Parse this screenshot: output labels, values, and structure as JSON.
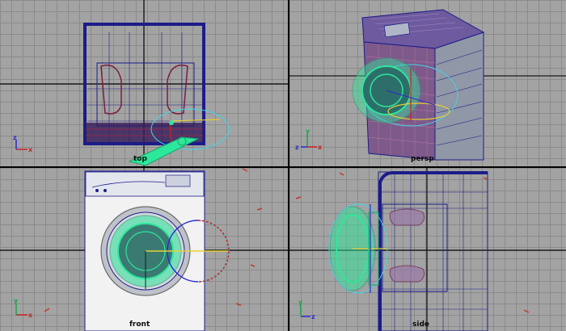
{
  "viewports": {
    "top": {
      "label": "top"
    },
    "persp": {
      "label": "persp"
    },
    "front": {
      "label": "front"
    },
    "side": {
      "label": "side"
    }
  },
  "axis": {
    "x_label": "x",
    "y_label": "y",
    "z_label": "z"
  },
  "colors": {
    "grid_background": "#a3a3a3",
    "grid_line": "#8b8b8b",
    "axis_line": "#1a1a1a",
    "wireframe": "#1c1c88",
    "selection": "#2de79b",
    "manip_cyan": "#41d6e8",
    "manip_red": "#c82222",
    "manip_yellow": "#e8d034",
    "manip_blue": "#2b2bd0",
    "cabinet": "#9097a6"
  }
}
